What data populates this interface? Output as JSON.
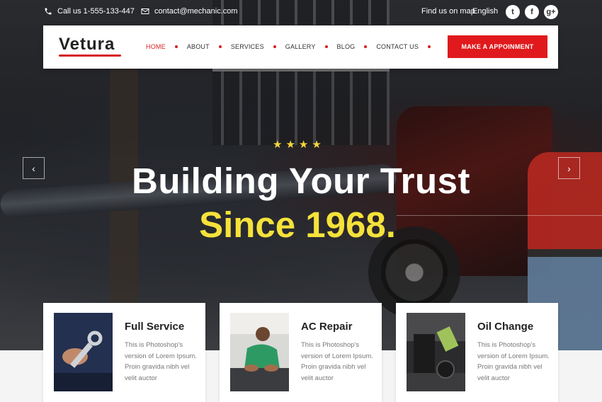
{
  "topbar": {
    "phone": "Call us 1-555-133-447",
    "email": "contact@mechanic.com",
    "find_us": "Find us on map",
    "language": "English",
    "social_icons": [
      "twitter-icon",
      "facebook-icon",
      "google-plus-icon"
    ]
  },
  "brand": {
    "logo_text": "Vetura",
    "accent_color": "#e0191c"
  },
  "nav": {
    "items": [
      "HOME",
      "ABOUT",
      "SERVICES",
      "GALLERY",
      "BLOG",
      "CONTACT US"
    ],
    "active": "HOME",
    "cta": "MAKE A APPOINMENT"
  },
  "hero": {
    "rating_stars": 4,
    "headline": "Building Your Trust",
    "subheadline": "Since 1968.",
    "subheadline_color": "#f5e23a",
    "prev_icon": "chevron-left-icon",
    "next_icon": "chevron-right-icon"
  },
  "services": [
    {
      "title": "Full Service",
      "text": "This is Photoshop's version of Lorem Ipsum. Proin gravida nibh vel velit auctor"
    },
    {
      "title": "AC Repair",
      "text": "This is Photoshop's version of Lorem Ipsum. Proin gravida nibh vel velit auctor"
    },
    {
      "title": "Oil Change",
      "text": "This is Photoshop's version of Lorem Ipsum. Proin gravida nibh vel velit auctor"
    }
  ]
}
